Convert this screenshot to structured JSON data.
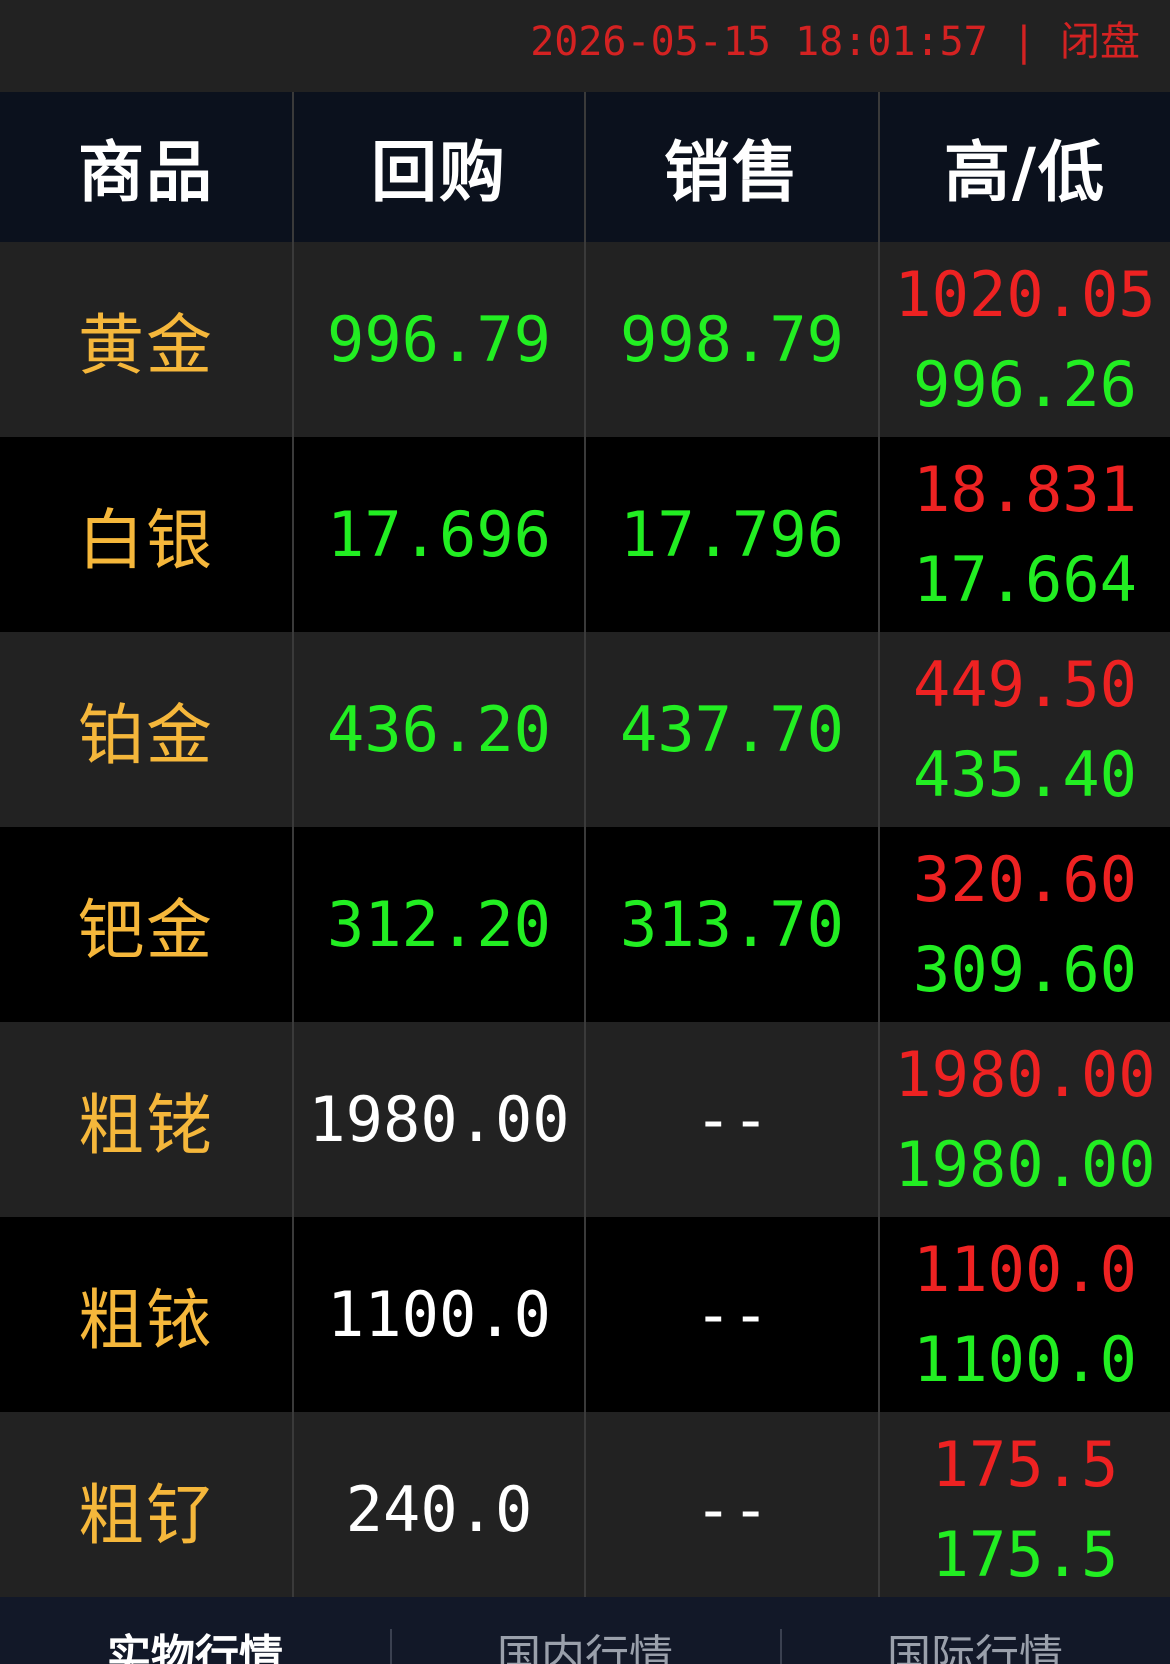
{
  "status_bar": {
    "timestamp": "2026-05-15 18:01:57 | 闭盘"
  },
  "colors": {
    "name": "#f5b73b",
    "up": "#ee2222",
    "down": "#22ee22",
    "neutral": "#ffffff",
    "timestamp": "#d42222"
  },
  "table": {
    "headers": [
      "商品",
      "回购",
      "销售",
      "高/低"
    ],
    "rows": [
      {
        "name": "黄金",
        "buyback": "996.79",
        "sell": "998.79",
        "high": "1020.05",
        "low": "996.26"
      },
      {
        "name": "白银",
        "buyback": "17.696",
        "sell": "17.796",
        "high": "18.831",
        "low": "17.664"
      },
      {
        "name": "铂金",
        "buyback": "436.20",
        "sell": "437.70",
        "high": "449.50",
        "low": "435.40"
      },
      {
        "name": "钯金",
        "buyback": "312.20",
        "sell": "313.70",
        "high": "320.60",
        "low": "309.60"
      },
      {
        "name": "粗铑",
        "buyback": "1980.00",
        "sell": "--",
        "high": "1980.00",
        "low": "1980.00"
      },
      {
        "name": "粗铱",
        "buyback": "1100.0",
        "sell": "--",
        "high": "1100.0",
        "low": "1100.0"
      },
      {
        "name": "粗钌",
        "buyback": "240.0",
        "sell": "--",
        "high": "175.5",
        "low": "175.5"
      }
    ]
  },
  "tabs": [
    {
      "label": "实物行情",
      "active": true
    },
    {
      "label": "国内行情",
      "active": false
    },
    {
      "label": "国际行情",
      "active": false
    }
  ]
}
